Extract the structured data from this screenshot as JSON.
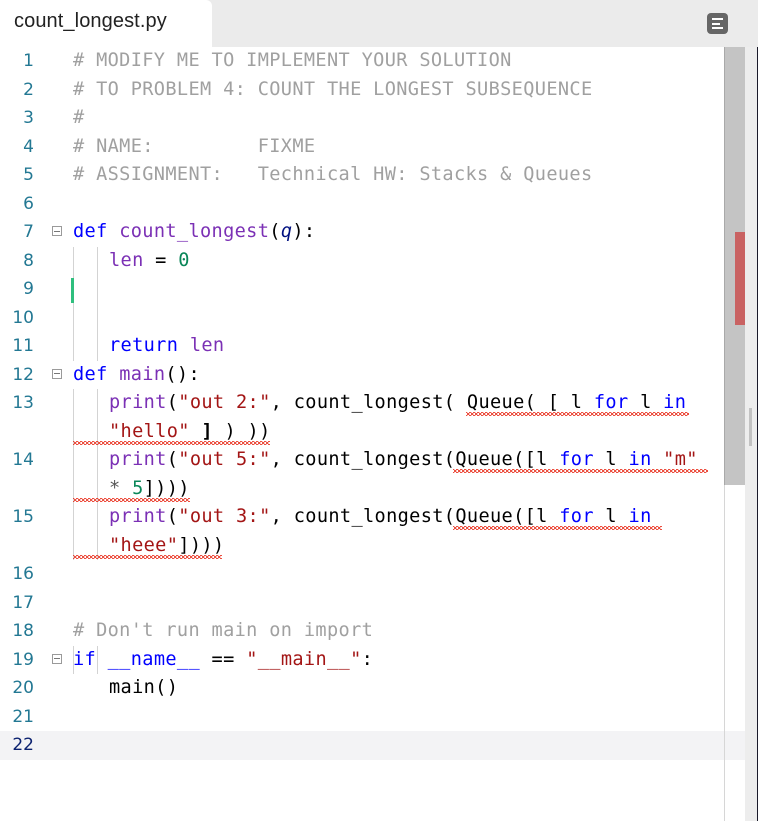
{
  "tab": {
    "filename": "count_longest.py",
    "menu_icon": "hamburger-menu-icon"
  },
  "editor": {
    "language": "python",
    "active_line": 22,
    "lines": [
      {
        "n": "1",
        "tokens": [
          {
            "t": "# MODIFY ME TO IMPLEMENT YOUR SOLUTION",
            "c": "comment"
          }
        ]
      },
      {
        "n": "2",
        "tokens": [
          {
            "t": "# TO PROBLEM 4: COUNT THE LONGEST SUBSEQUENCE",
            "c": "comment"
          }
        ]
      },
      {
        "n": "3",
        "tokens": [
          {
            "t": "#",
            "c": "comment"
          }
        ]
      },
      {
        "n": "4",
        "tokens": [
          {
            "t": "# NAME:         FIXME",
            "c": "comment"
          }
        ]
      },
      {
        "n": "5",
        "tokens": [
          {
            "t": "# ASSIGNMENT:   Technical HW: Stacks & Queues",
            "c": "comment"
          }
        ]
      },
      {
        "n": "6",
        "tokens": []
      },
      {
        "n": "7",
        "fold": true,
        "tokens": [
          {
            "t": "def",
            "c": "kw"
          },
          {
            "t": " ",
            "c": "plain"
          },
          {
            "t": "count_longest",
            "c": "fn"
          },
          {
            "t": "(",
            "c": "plain"
          },
          {
            "t": "q",
            "c": "param"
          },
          {
            "t": "):",
            "c": "plain"
          }
        ]
      },
      {
        "n": "8",
        "indent": 1,
        "tokens": [
          {
            "t": "len",
            "c": "fn"
          },
          {
            "t": " = ",
            "c": "plain"
          },
          {
            "t": "0",
            "c": "num"
          }
        ]
      },
      {
        "n": "9",
        "tokens": []
      },
      {
        "n": "10",
        "tokens": []
      },
      {
        "n": "11",
        "indent": 1,
        "tokens": [
          {
            "t": "return",
            "c": "kw"
          },
          {
            "t": " ",
            "c": "plain"
          },
          {
            "t": "len",
            "c": "fn"
          }
        ]
      },
      {
        "n": "12",
        "fold": true,
        "tokens": [
          {
            "t": "def",
            "c": "kw"
          },
          {
            "t": " ",
            "c": "plain"
          },
          {
            "t": "main",
            "c": "fn"
          },
          {
            "t": "():",
            "c": "plain"
          }
        ]
      },
      {
        "n": "13",
        "indent": 1,
        "tokens": [
          {
            "t": "print",
            "c": "fn"
          },
          {
            "t": "(",
            "c": "plain"
          },
          {
            "t": "\"out 2:\"",
            "c": "str"
          },
          {
            "t": ", count_longest( Queue( [ l ",
            "c": "plain"
          },
          {
            "t": "for",
            "c": "kw"
          },
          {
            "t": " l ",
            "c": "plain"
          },
          {
            "t": "in",
            "c": "kw"
          }
        ]
      },
      {
        "n": "",
        "wrap": true,
        "indent": 1,
        "tokens": [
          {
            "t": "\"hello\"",
            "c": "str"
          },
          {
            "t": " ",
            "c": "plain"
          },
          {
            "t": "]",
            "c": "bracket"
          },
          {
            "t": " ) ))",
            "c": "plain"
          }
        ]
      },
      {
        "n": "14",
        "indent": 1,
        "tokens": [
          {
            "t": "print",
            "c": "fn"
          },
          {
            "t": "(",
            "c": "plain"
          },
          {
            "t": "\"out 5:\"",
            "c": "str"
          },
          {
            "t": ", count_longest(Queue([l ",
            "c": "plain"
          },
          {
            "t": "for",
            "c": "kw"
          },
          {
            "t": " l ",
            "c": "plain"
          },
          {
            "t": "in",
            "c": "kw"
          },
          {
            "t": " ",
            "c": "plain"
          },
          {
            "t": "\"m\"",
            "c": "str"
          }
        ]
      },
      {
        "n": "",
        "wrap": true,
        "indent": 1,
        "tokens": [
          {
            "t": "* ",
            "c": "op"
          },
          {
            "t": "5",
            "c": "num"
          },
          {
            "t": "])))",
            "c": "plain"
          }
        ]
      },
      {
        "n": "15",
        "indent": 1,
        "tokens": [
          {
            "t": "print",
            "c": "fn"
          },
          {
            "t": "(",
            "c": "plain"
          },
          {
            "t": "\"out 3:\"",
            "c": "str"
          },
          {
            "t": ", count_longest(Queue([l ",
            "c": "plain"
          },
          {
            "t": "for",
            "c": "kw"
          },
          {
            "t": " l ",
            "c": "plain"
          },
          {
            "t": "in",
            "c": "kw"
          }
        ]
      },
      {
        "n": "",
        "wrap": true,
        "indent": 1,
        "tokens": [
          {
            "t": "\"heee\"",
            "c": "str"
          },
          {
            "t": "])))",
            "c": "plain"
          }
        ]
      },
      {
        "n": "16",
        "tokens": []
      },
      {
        "n": "17",
        "tokens": []
      },
      {
        "n": "18",
        "tokens": [
          {
            "t": "# Don't run main on import",
            "c": "comment"
          }
        ]
      },
      {
        "n": "19",
        "fold": true,
        "tokens": [
          {
            "t": "if",
            "c": "kw"
          },
          {
            "t": " ",
            "c": "plain"
          },
          {
            "t": "__name__",
            "c": "kw"
          },
          {
            "t": " == ",
            "c": "plain"
          },
          {
            "t": "\"__main__\"",
            "c": "str"
          },
          {
            "t": ":",
            "c": "plain"
          }
        ]
      },
      {
        "n": "20",
        "indent": 1,
        "tokens": [
          {
            "t": "main()",
            "c": "plain"
          }
        ]
      },
      {
        "n": "21",
        "tokens": []
      },
      {
        "n": "22",
        "tokens": []
      }
    ]
  },
  "colors": {
    "line_number": "#237893",
    "active_line_number": "#0b216f",
    "keyword": "#0000ff",
    "function": "#7b30b5",
    "string": "#a31515",
    "number": "#098658",
    "comment": "#a0a0a0",
    "error_squiggle": "#e51400",
    "cursor_marker": "#2fbf7e",
    "overview_error_marker": "#c96262"
  }
}
